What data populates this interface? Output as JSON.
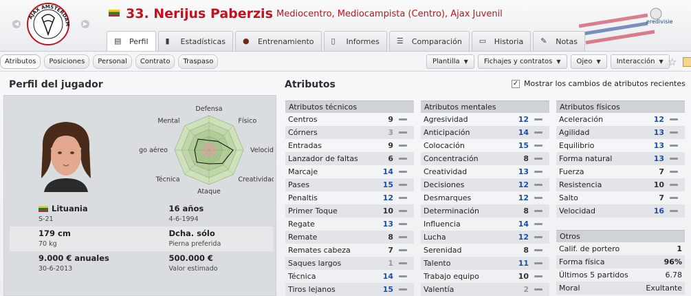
{
  "header": {
    "name": "33. Nerijus Paberzis",
    "subtitle": "Mediocentro, Mediocampista (Centro), Ajax Juvenil",
    "club_logo_text": "AJAX AMSTERDAM",
    "league_logo_text": "eredivisie"
  },
  "tabs": [
    {
      "label": "Perfil",
      "icon": "profile-card-icon"
    },
    {
      "label": "Estadísticas",
      "icon": "bar-chart-icon"
    },
    {
      "label": "Entrenamiento",
      "icon": "ball-icon"
    },
    {
      "label": "Informes",
      "icon": "document-icon"
    },
    {
      "label": "Comparación",
      "icon": "compare-icon"
    },
    {
      "label": "Historia",
      "icon": "history-icon"
    },
    {
      "label": "Notas",
      "icon": "notes-icon"
    }
  ],
  "subtabs": [
    "Atributos",
    "Posiciones",
    "Personal",
    "Contrato",
    "Traspaso"
  ],
  "menus": [
    "Plantilla",
    "Fichajes y contratos",
    "Ojeo",
    "Interacción"
  ],
  "profile": {
    "title": "Perfil del jugador",
    "radar_labels": [
      "Defensa",
      "Físico",
      "Velocidad",
      "Creatividad",
      "Ataque",
      "Técnica",
      "Juego aéreo",
      "Mental"
    ],
    "radar_levels": [
      0.28,
      0.36,
      0.7,
      0.55,
      0.4,
      0.5,
      0.42,
      0.45
    ],
    "bio": [
      {
        "main": "Lituania",
        "sub": "S-21",
        "main2": "16 años",
        "sub2": "4-6-1994"
      },
      {
        "main": "179 cm",
        "sub": "70 kg",
        "main2": "Dcha. sólo",
        "sub2": "Pierna preferida"
      },
      {
        "main": "9.000 € anuales",
        "sub": "30-6-2013",
        "main2": "500.000 €",
        "sub2": "Valor estimado"
      }
    ]
  },
  "attributes": {
    "title": "Atributos",
    "show_changes_label": "Mostrar los cambios de atributos recientes",
    "technical": {
      "header": "Atributos técnicos",
      "rows": [
        {
          "name": "Centros",
          "value": "9"
        },
        {
          "name": "Córners",
          "value": "3"
        },
        {
          "name": "Entradas",
          "value": "9"
        },
        {
          "name": "Lanzador de faltas",
          "value": "6"
        },
        {
          "name": "Marcaje",
          "value": "14"
        },
        {
          "name": "Pases",
          "value": "15"
        },
        {
          "name": "Penaltis",
          "value": "12"
        },
        {
          "name": "Primer Toque",
          "value": "10"
        },
        {
          "name": "Regate",
          "value": "13"
        },
        {
          "name": "Remate",
          "value": "8"
        },
        {
          "name": "Remates cabeza",
          "value": "7"
        },
        {
          "name": "Saques largos",
          "value": "1"
        },
        {
          "name": "Técnica",
          "value": "14"
        },
        {
          "name": "Tiros lejanos",
          "value": "15"
        }
      ]
    },
    "mental": {
      "header": "Atributos mentales",
      "rows": [
        {
          "name": "Agresividad",
          "value": "12"
        },
        {
          "name": "Anticipación",
          "value": "14"
        },
        {
          "name": "Colocación",
          "value": "15"
        },
        {
          "name": "Concentración",
          "value": "8"
        },
        {
          "name": "Creatividad",
          "value": "13"
        },
        {
          "name": "Decisiones",
          "value": "12"
        },
        {
          "name": "Desmarques",
          "value": "12"
        },
        {
          "name": "Determinación",
          "value": "8"
        },
        {
          "name": "Influencia",
          "value": "14"
        },
        {
          "name": "Lucha",
          "value": "12"
        },
        {
          "name": "Serenidad",
          "value": "8"
        },
        {
          "name": "Talento",
          "value": "11"
        },
        {
          "name": "Trabajo equipo",
          "value": "10"
        },
        {
          "name": "Valentía",
          "value": "2"
        }
      ]
    },
    "physical": {
      "header": "Atributos físicos",
      "rows": [
        {
          "name": "Aceleración",
          "value": "12"
        },
        {
          "name": "Agilidad",
          "value": "13"
        },
        {
          "name": "Equilibrio",
          "value": "13"
        },
        {
          "name": "Forma natural",
          "value": "13"
        },
        {
          "name": "Fuerza",
          "value": "7"
        },
        {
          "name": "Resistencia",
          "value": "10"
        },
        {
          "name": "Salto",
          "value": "7"
        },
        {
          "name": "Velocidad",
          "value": "16"
        }
      ]
    },
    "others": {
      "header": "Otros",
      "rows": [
        {
          "name": "Calif. de portero",
          "value": "1"
        },
        {
          "name": "Forma física",
          "value": "96%"
        },
        {
          "name": "Últimos 5 partidos",
          "value": "6.78"
        },
        {
          "name": "Moral",
          "value": "Exultante"
        }
      ]
    }
  },
  "colors": {
    "name_red": "#c3121d",
    "good_blue": "#1e4ea8",
    "low_grey": "#999999"
  }
}
